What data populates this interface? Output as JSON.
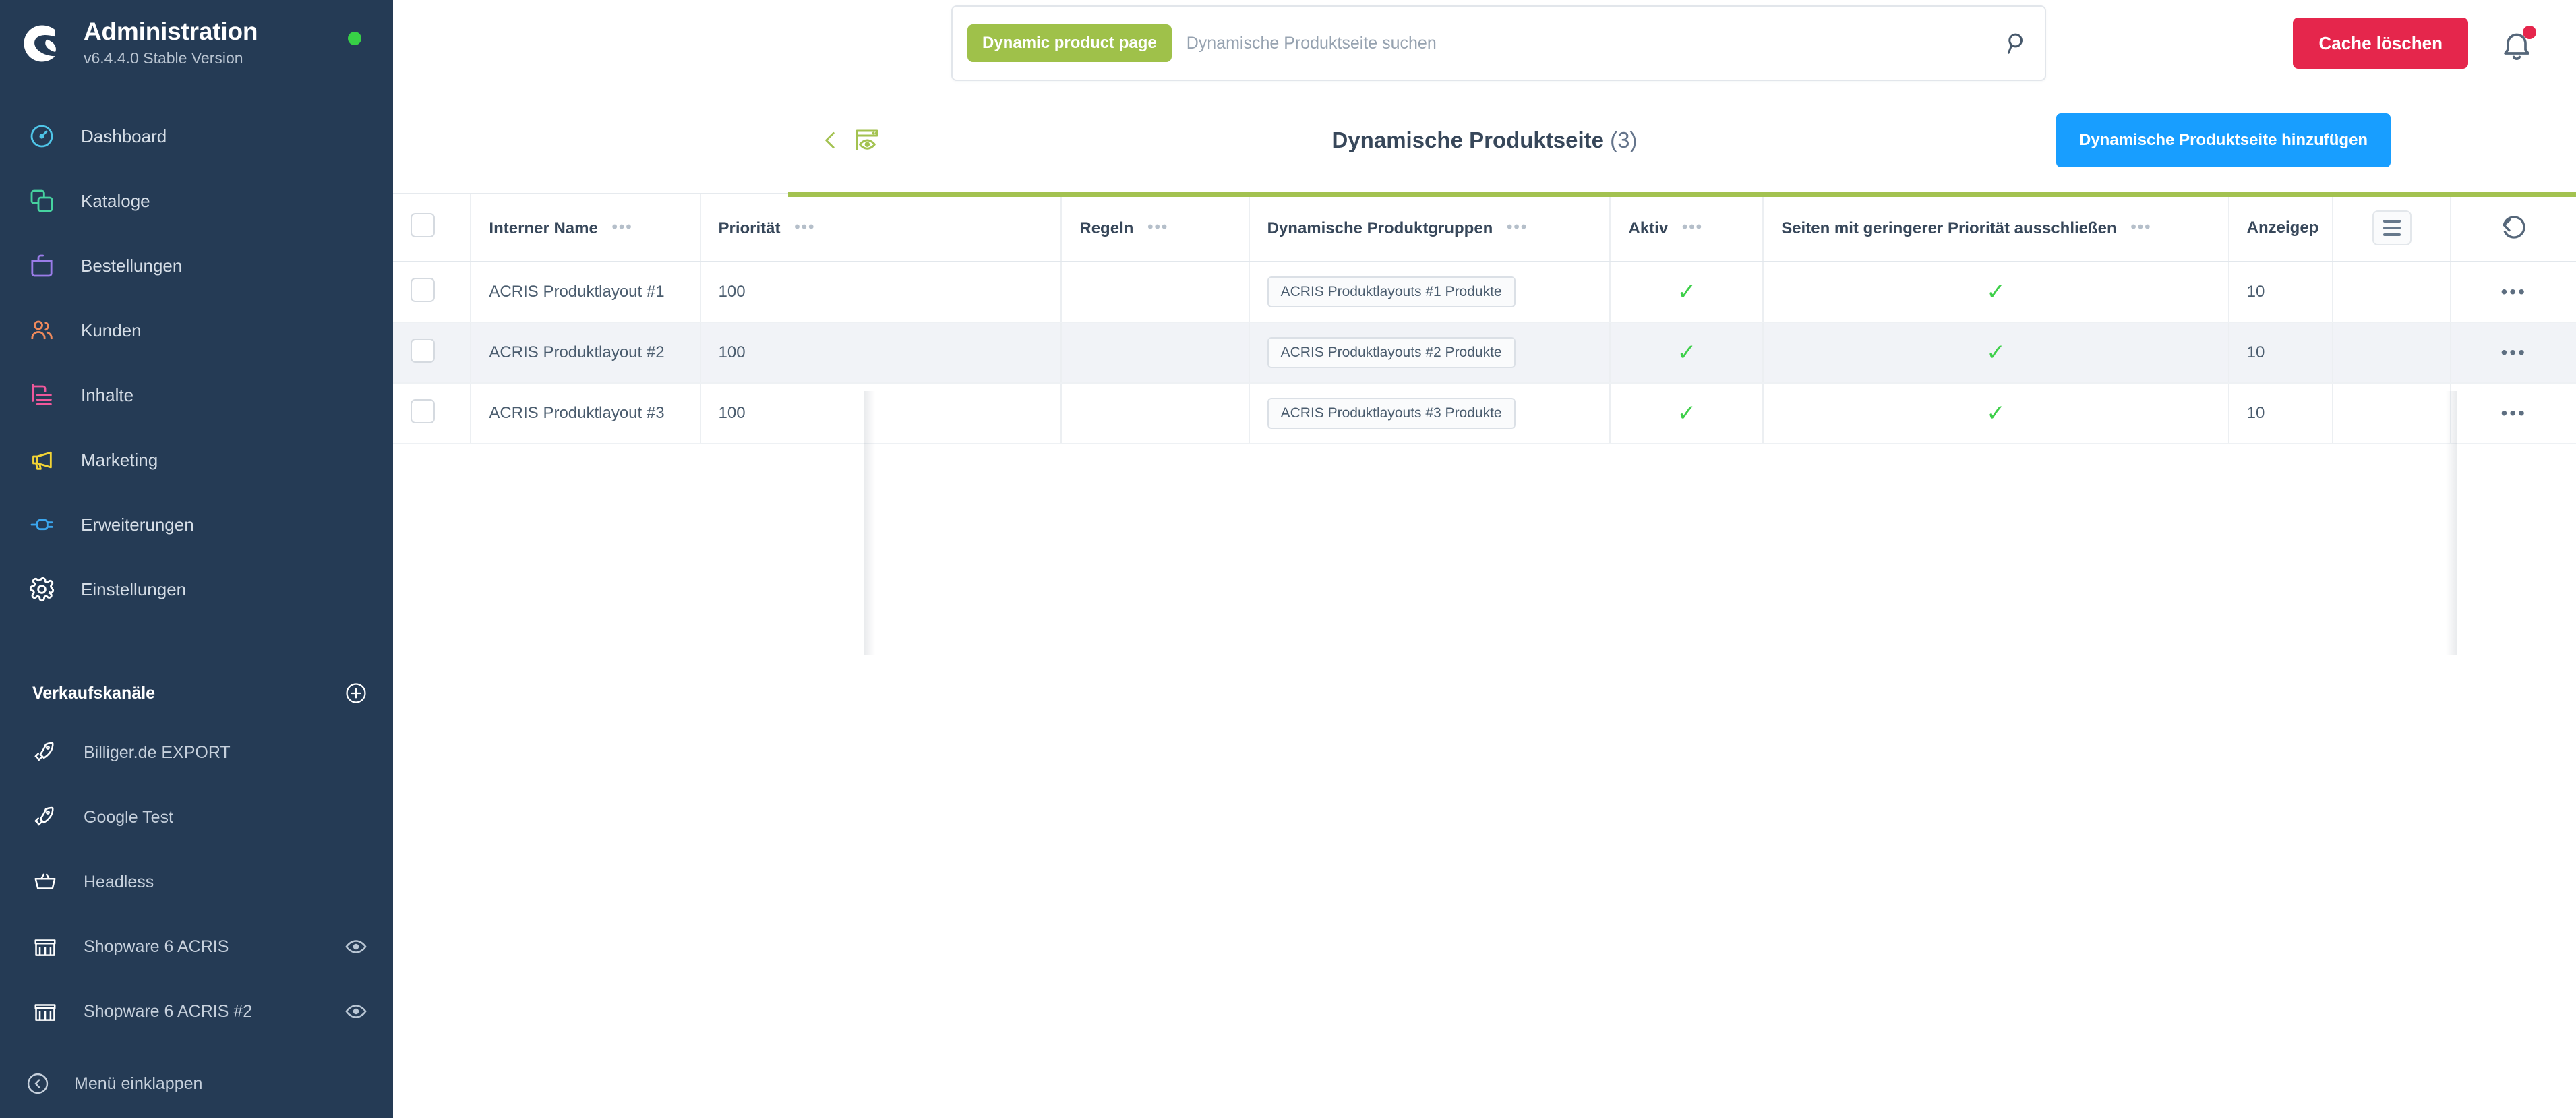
{
  "sidebar": {
    "brand": {
      "title": "Administration",
      "version": "v6.4.4.0 Stable Version"
    },
    "nav": [
      {
        "label": "Dashboard",
        "icon": "gauge-icon"
      },
      {
        "label": "Kataloge",
        "icon": "catalog-icon"
      },
      {
        "label": "Bestellungen",
        "icon": "bag-icon"
      },
      {
        "label": "Kunden",
        "icon": "users-icon"
      },
      {
        "label": "Inhalte",
        "icon": "content-icon"
      },
      {
        "label": "Marketing",
        "icon": "megaphone-icon"
      },
      {
        "label": "Erweiterungen",
        "icon": "plug-icon"
      },
      {
        "label": "Einstellungen",
        "icon": "gear-icon"
      }
    ],
    "sales_channels_title": "Verkaufskanäle",
    "sales_channels": [
      {
        "label": "Billiger.de EXPORT",
        "icon": "rocket-icon",
        "has_eye": false
      },
      {
        "label": "Google Test",
        "icon": "rocket-icon",
        "has_eye": false
      },
      {
        "label": "Headless",
        "icon": "basket-icon",
        "has_eye": false
      },
      {
        "label": "Shopware 6 ACRIS",
        "icon": "storefront-icon",
        "has_eye": true
      },
      {
        "label": "Shopware 6 ACRIS #2",
        "icon": "storefront-icon",
        "has_eye": true
      }
    ],
    "collapse_label": "Menü einklappen"
  },
  "topbar": {
    "search_tag": "Dynamic product page",
    "search_value": "",
    "search_placeholder": "Dynamische Produktseite suchen",
    "cache_button": "Cache löschen"
  },
  "smartbar": {
    "title": "Dynamische Produktseite",
    "count": "(3)",
    "add_button": "Dynamische Produktseite hinzufügen"
  },
  "table": {
    "columns": [
      {
        "key": "check",
        "label": ""
      },
      {
        "key": "name",
        "label": "Interner Name"
      },
      {
        "key": "prio",
        "label": "Priorität"
      },
      {
        "key": "rules",
        "label": "Regeln"
      },
      {
        "key": "groups",
        "label": "Dynamische Produktgruppen"
      },
      {
        "key": "aktiv",
        "label": "Aktiv"
      },
      {
        "key": "excl",
        "label": "Seiten mit geringerer Priorität ausschließen"
      },
      {
        "key": "pos",
        "label": "Anzeigep"
      }
    ],
    "rows": [
      {
        "name": "ACRIS Produktlayout #1",
        "prio": "100",
        "rules": "",
        "groups": "ACRIS Produktlayouts #1 Produkte",
        "aktiv": "✓",
        "excl": "✓",
        "pos": "10",
        "context_menu": "•••"
      },
      {
        "name": "ACRIS Produktlayout #2",
        "prio": "100",
        "rules": "",
        "groups": "ACRIS Produktlayouts #2 Produkte",
        "aktiv": "✓",
        "excl": "✓",
        "pos": "10",
        "context_menu": "•••"
      },
      {
        "name": "ACRIS Produktlayout #3",
        "prio": "100",
        "rules": "",
        "groups": "ACRIS Produktlayouts #3 Produkte",
        "aktiv": "✓",
        "excl": "✓",
        "pos": "10",
        "context_menu": "•••"
      }
    ],
    "header_dots": "•••"
  },
  "colors": {
    "sidebar_bg": "#253b55",
    "accent_green": "#a3c250",
    "primary_blue": "#189eff",
    "danger_red": "#e5264c",
    "check_green": "#3ecf4a",
    "tag_green": "#9fc14a"
  }
}
